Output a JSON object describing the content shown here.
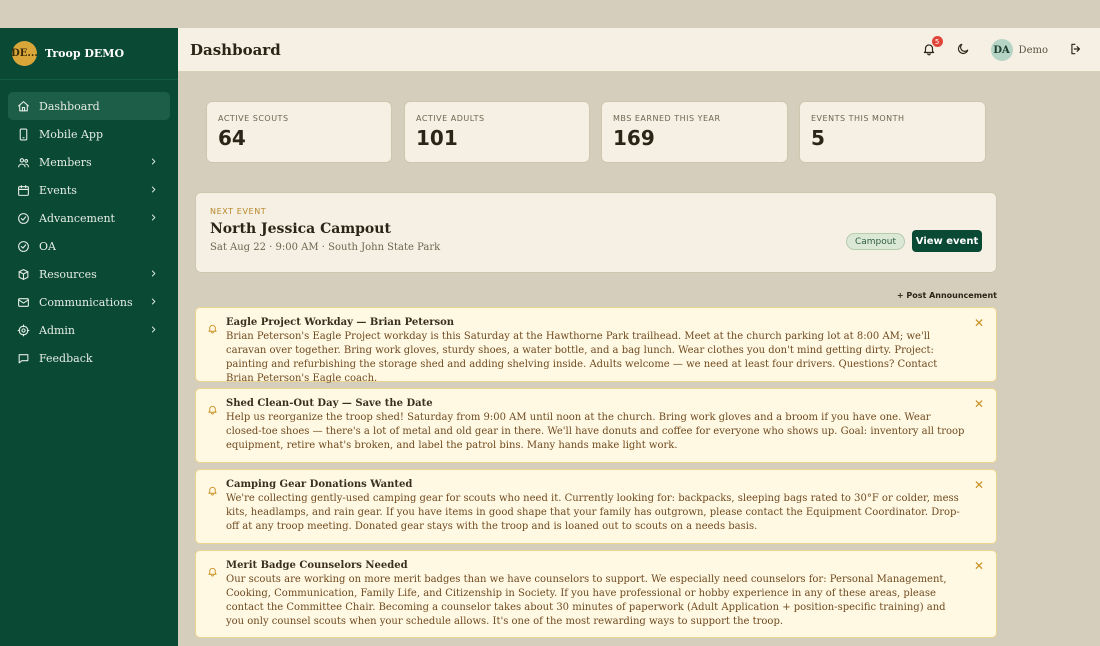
{
  "brand": {
    "avatar": "DE...",
    "name": "Troop DEMO"
  },
  "nav": [
    {
      "label": "Dashboard",
      "icon": "home-icon",
      "active": true,
      "chevron": false
    },
    {
      "label": "Mobile App",
      "icon": "phone-icon",
      "active": false,
      "chevron": false
    },
    {
      "label": "Members",
      "icon": "users-icon",
      "active": false,
      "chevron": true
    },
    {
      "label": "Events",
      "icon": "calendar-icon",
      "active": false,
      "chevron": true
    },
    {
      "label": "Advancement",
      "icon": "check-circle-icon",
      "active": false,
      "chevron": true
    },
    {
      "label": "OA",
      "icon": "check-circle-icon",
      "active": false,
      "chevron": false
    },
    {
      "label": "Resources",
      "icon": "box-icon",
      "active": false,
      "chevron": true
    },
    {
      "label": "Communications",
      "icon": "mail-icon",
      "active": false,
      "chevron": true
    },
    {
      "label": "Admin",
      "icon": "gear-icon",
      "active": false,
      "chevron": true
    },
    {
      "label": "Feedback",
      "icon": "chat-icon",
      "active": false,
      "chevron": false
    }
  ],
  "header": {
    "title": "Dashboard",
    "notif_count": "5",
    "user_initials": "DA",
    "user_name": "Demo"
  },
  "stats": [
    {
      "label": "Active Scouts",
      "value": "64"
    },
    {
      "label": "Active Adults",
      "value": "101"
    },
    {
      "label": "MBs Earned This Year",
      "value": "169"
    },
    {
      "label": "Events This Month",
      "value": "5"
    }
  ],
  "next_event": {
    "label": "Next Event",
    "title": "North Jessica Campout",
    "meta": "Sat Aug 22 · 9:00 AM · South John State Park",
    "tag": "Campout",
    "button": "View event"
  },
  "post_announcement": "+ Post Announcement",
  "announcements": [
    {
      "title": "Eagle Project Workday — Brian Peterson",
      "body": "Brian Peterson's Eagle Project workday is this Saturday at the Hawthorne Park trailhead. Meet at the church parking lot at 8:00 AM; we'll caravan over together. Bring work gloves, sturdy shoes, a water bottle, and a bag lunch. Wear clothes you don't mind getting dirty. Project: painting and refurbishing the storage shed and adding shelving inside. Adults welcome — we need at least four drivers. Questions? Contact Brian Peterson's Eagle coach."
    },
    {
      "title": "Shed Clean-Out Day — Save the Date",
      "body": "Help us reorganize the troop shed! Saturday from 9:00 AM until noon at the church. Bring work gloves and a broom if you have one. Wear closed-toe shoes — there's a lot of metal and old gear in there. We'll have donuts and coffee for everyone who shows up. Goal: inventory all troop equipment, retire what's broken, and label the patrol bins. Many hands make light work."
    },
    {
      "title": "Camping Gear Donations Wanted",
      "body": "We're collecting gently-used camping gear for scouts who need it. Currently looking for: backpacks, sleeping bags rated to 30°F or colder, mess kits, headlamps, and rain gear. If you have items in good shape that your family has outgrown, please contact the Equipment Coordinator. Drop-off at any troop meeting. Donated gear stays with the troop and is loaned out to scouts on a needs basis."
    },
    {
      "title": "Merit Badge Counselors Needed",
      "body": "Our scouts are working on more merit badges than we have counselors to support. We especially need counselors for: Personal Management, Cooking, Communication, Family Life, and Citizenship in Society. If you have professional or hobby experience in any of these areas, please contact the Committee Chair. Becoming a counselor takes about 30 minutes of paperwork (Adult Application + position-specific training) and you only counsel scouts when your schedule allows. It's one of the most rewarding ways to support the troop."
    }
  ]
}
